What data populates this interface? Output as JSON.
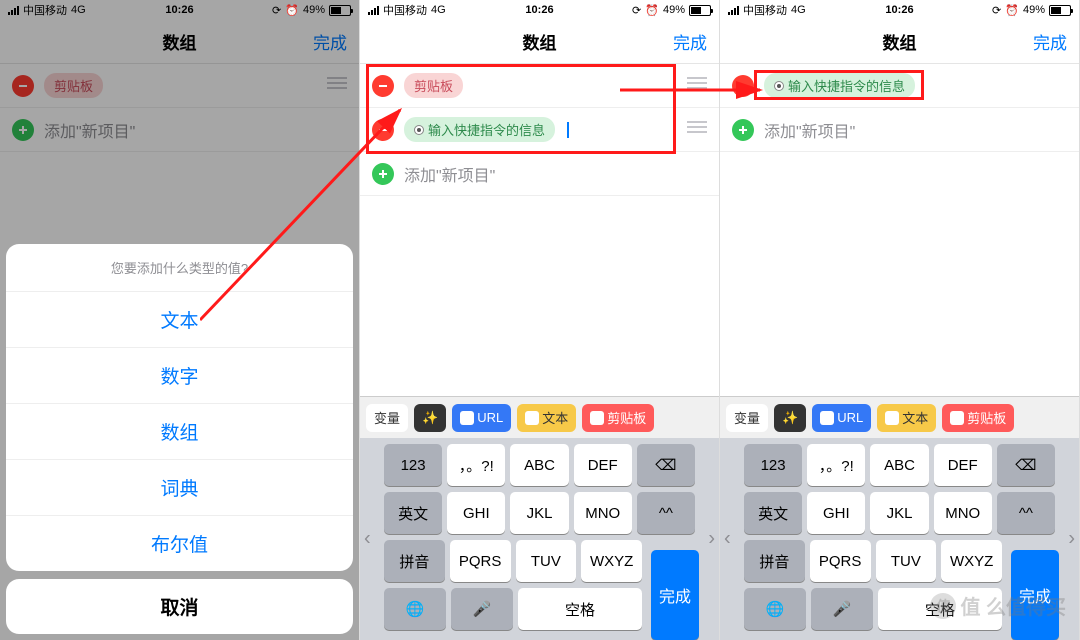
{
  "status": {
    "carrier": "中国移动",
    "network": "4G",
    "time": "10:26",
    "battery_pct": "49%"
  },
  "nav": {
    "title": "数组",
    "done": "完成"
  },
  "pills": {
    "clipboard": "剪贴板",
    "shortcut_input": "输入快捷指令的信息"
  },
  "add_item": "添加\"新项目\"",
  "sheet": {
    "prompt": "您要添加什么类型的值?",
    "items": [
      "文本",
      "数字",
      "数组",
      "词典",
      "布尔值"
    ],
    "cancel": "取消"
  },
  "suggest": {
    "variable": "变量",
    "url": "URL",
    "text": "文本",
    "clipboard": "剪贴板"
  },
  "keyboard": {
    "r1": [
      "123",
      "，。?!",
      "ABC",
      "DEF"
    ],
    "r2": [
      "英文",
      "GHI",
      "JKL",
      "MNO"
    ],
    "r3": [
      "拼音",
      "PQRS",
      "TUV",
      "WXYZ"
    ],
    "space": "空格",
    "done": "完成",
    "emoji": "^^"
  },
  "watermark": "值  么值得买"
}
